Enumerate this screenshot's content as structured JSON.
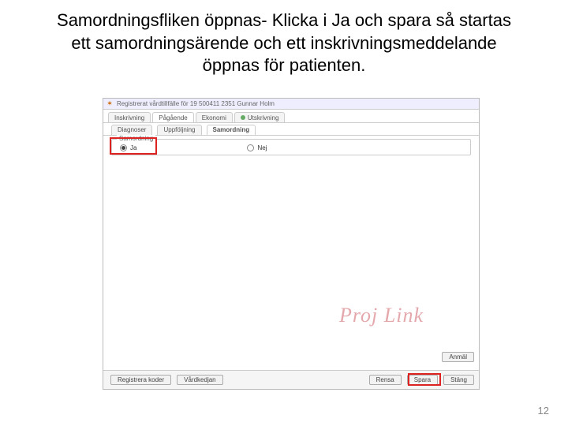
{
  "slide": {
    "title": "Samordningsfliken öppnas- Klicka i Ja och spara så startas ett samordningsärende och ett inskrivningsmeddelande öppnas  för patienten."
  },
  "titlebar": {
    "text": "Registrerat vårdtillfälle för 19 500411 2351 Gunnar Holm"
  },
  "tabs": {
    "items": [
      {
        "label": "Inskrivning"
      },
      {
        "label": "Pågående"
      },
      {
        "label": "Ekonomi"
      },
      {
        "label": "Utskrivning"
      }
    ],
    "active_index": 1
  },
  "subtabs": {
    "items": [
      {
        "label": "Diagnoser"
      },
      {
        "label": "Uppföljning"
      },
      {
        "label": "Samordning"
      }
    ],
    "active_index": 2
  },
  "group": {
    "label": "Samordning",
    "option_ja": "Ja",
    "option_nej": "Nej",
    "selected": "ja"
  },
  "side_button": {
    "label": "Anmäl"
  },
  "footer": {
    "left": [
      {
        "label": "Registrera koder"
      },
      {
        "label": "Vårdkedjan"
      }
    ],
    "right": [
      {
        "label": "Rensa"
      },
      {
        "label": "Spara"
      },
      {
        "label": "Stäng"
      }
    ]
  },
  "watermark": "Proj Link",
  "page_number": "12"
}
